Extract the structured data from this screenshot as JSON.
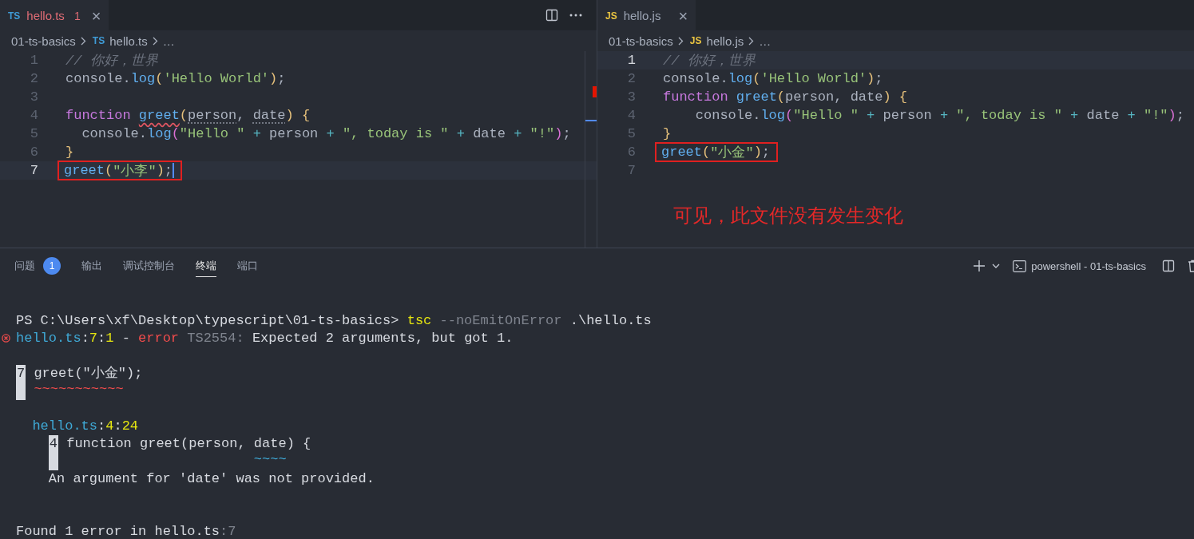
{
  "editors": [
    {
      "tab": {
        "kind": "ts",
        "badge": "TS",
        "title": "hello.ts",
        "has_error": true,
        "problems": "1",
        "close": "×",
        "selected": true
      },
      "actions": [
        {
          "kind": "split"
        },
        {
          "kind": "more"
        }
      ],
      "breadcrumb": {
        "folder": "01-ts-basics",
        "kind": "ts",
        "badge": "TS",
        "file": "hello.ts",
        "tail": "…"
      },
      "lines": [
        {
          "number": "1",
          "tokens": [
            {
              "text": "// 你好，世界",
              "kind": "cmt"
            }
          ]
        },
        {
          "number": "2",
          "tokens": [
            {
              "text": "console.",
              "kind": "plain"
            },
            {
              "text": "log",
              "kind": "fn"
            },
            {
              "text": "(",
              "kind": "b1"
            },
            {
              "text": "'Hello World'",
              "kind": "str"
            },
            {
              "text": ")",
              "kind": "b1"
            },
            {
              "text": ";",
              "kind": "plain"
            }
          ]
        },
        {
          "number": "3"
        },
        {
          "number": "4",
          "tokens": [
            {
              "text": "function ",
              "kind": "kw"
            },
            {
              "text": "greet",
              "kind": "fn-error"
            },
            {
              "text": "(",
              "kind": "b1"
            },
            {
              "text": "person",
              "kind": "param-hint"
            },
            {
              "text": ", ",
              "kind": "plain"
            },
            {
              "text": "date",
              "kind": "param-hint"
            },
            {
              "text": ")",
              "kind": "b1"
            },
            {
              "text": " {",
              "kind": "b1"
            }
          ]
        },
        {
          "number": "5",
          "tokens": [
            {
              "text": "  console.",
              "kind": "plain"
            },
            {
              "text": "log",
              "kind": "fn"
            },
            {
              "text": "(",
              "kind": "b2"
            },
            {
              "text": "\"Hello \"",
              "kind": "str"
            },
            {
              "text": " + ",
              "kind": "op"
            },
            {
              "text": "person",
              "kind": "plain"
            },
            {
              "text": " + ",
              "kind": "op"
            },
            {
              "text": "\", today is \"",
              "kind": "str"
            },
            {
              "text": " + ",
              "kind": "op"
            },
            {
              "text": "date",
              "kind": "plain"
            },
            {
              "text": " + ",
              "kind": "op"
            },
            {
              "text": "\"!\"",
              "kind": "str"
            },
            {
              "text": ")",
              "kind": "b2"
            },
            {
              "text": ";",
              "kind": "plain"
            }
          ]
        },
        {
          "number": "6",
          "tokens": [
            {
              "text": "}",
              "kind": "b1"
            }
          ]
        },
        {
          "number": "7",
          "current": true,
          "boxed": true,
          "cursor": true,
          "tokens": [
            {
              "text": "greet",
              "kind": "fn"
            },
            {
              "text": "(",
              "kind": "b1"
            },
            {
              "text": "\"小李\"",
              "kind": "str"
            },
            {
              "text": ")",
              "kind": "b1"
            },
            {
              "text": ";",
              "kind": "plain"
            }
          ]
        }
      ]
    },
    {
      "tab": {
        "kind": "js",
        "badge": "JS",
        "title": "hello.js",
        "has_error": false,
        "close": "×",
        "selected": true
      },
      "breadcrumb": {
        "folder": "01-ts-basics",
        "kind": "js",
        "badge": "JS",
        "file": "hello.js",
        "tail": "…"
      },
      "lines": [
        {
          "number": "1",
          "current": true,
          "tokens": [
            {
              "text": "// 你好，世界",
              "kind": "cmt"
            }
          ]
        },
        {
          "number": "2",
          "tokens": [
            {
              "text": "console.",
              "kind": "plain"
            },
            {
              "text": "log",
              "kind": "fn"
            },
            {
              "text": "(",
              "kind": "b1"
            },
            {
              "text": "'Hello World'",
              "kind": "str"
            },
            {
              "text": ")",
              "kind": "b1"
            },
            {
              "text": ";",
              "kind": "plain"
            }
          ]
        },
        {
          "number": "3",
          "tokens": [
            {
              "text": "function ",
              "kind": "kw"
            },
            {
              "text": "greet",
              "kind": "fn"
            },
            {
              "text": "(",
              "kind": "b1"
            },
            {
              "text": "person, date",
              "kind": "plain"
            },
            {
              "text": ")",
              "kind": "b1"
            },
            {
              "text": " {",
              "kind": "b1"
            }
          ]
        },
        {
          "number": "4",
          "tokens": [
            {
              "text": "    console.",
              "kind": "plain"
            },
            {
              "text": "log",
              "kind": "fn"
            },
            {
              "text": "(",
              "kind": "b2"
            },
            {
              "text": "\"Hello \"",
              "kind": "str"
            },
            {
              "text": " + ",
              "kind": "op"
            },
            {
              "text": "person",
              "kind": "plain"
            },
            {
              "text": " + ",
              "kind": "op"
            },
            {
              "text": "\", today is \"",
              "kind": "str"
            },
            {
              "text": " + ",
              "kind": "op"
            },
            {
              "text": "date",
              "kind": "plain"
            },
            {
              "text": " + ",
              "kind": "op"
            },
            {
              "text": "\"!\"",
              "kind": "str"
            },
            {
              "text": ")",
              "kind": "b2"
            },
            {
              "text": ";",
              "kind": "plain"
            }
          ]
        },
        {
          "number": "5",
          "tokens": [
            {
              "text": "}",
              "kind": "b1"
            }
          ]
        },
        {
          "number": "6",
          "boxed": true,
          "tokens": [
            {
              "text": "greet",
              "kind": "fn"
            },
            {
              "text": "(",
              "kind": "b1"
            },
            {
              "text": "\"小金\"",
              "kind": "str"
            },
            {
              "text": ")",
              "kind": "b1"
            },
            {
              "text": ";",
              "kind": "plain"
            }
          ]
        },
        {
          "number": "7"
        }
      ],
      "annotation": {
        "text": "可见，此文件没有发生变化"
      }
    }
  ],
  "panel": {
    "tabs": [
      {
        "label": "问题",
        "selected": false,
        "badge": "1"
      },
      {
        "label": "输出",
        "selected": false
      },
      {
        "label": "调试控制台",
        "selected": false
      },
      {
        "label": "终端",
        "selected": true
      },
      {
        "label": "端口",
        "selected": false
      }
    ],
    "shell": "powershell - 01-ts-basics",
    "terminal": [
      {
        "kind": "blank"
      },
      {
        "kind": "text",
        "tokens": [
          {
            "text": "PS C:\\Users\\xf\\Desktop\\typescript\\01-ts-basics> ",
            "kind": "plain"
          },
          {
            "text": "tsc",
            "kind": "cmd"
          },
          {
            "text": " --noEmitOnError",
            "kind": "dim"
          },
          {
            "text": " .\\hello.ts",
            "kind": "plain"
          }
        ]
      },
      {
        "kind": "text",
        "error_mark": true,
        "tokens": [
          {
            "text": "hello.ts",
            "kind": "path"
          },
          {
            "text": ":",
            "kind": "plain"
          },
          {
            "text": "7",
            "kind": "num"
          },
          {
            "text": ":",
            "kind": "plain"
          },
          {
            "text": "1",
            "kind": "num"
          },
          {
            "text": " - ",
            "kind": "plain"
          },
          {
            "text": "error",
            "kind": "err"
          },
          {
            "text": " TS2554:",
            "kind": "dim"
          },
          {
            "text": " Expected 2 arguments, but got 1.",
            "kind": "plain"
          }
        ]
      },
      {
        "kind": "blank"
      },
      {
        "kind": "snippet",
        "number": "7",
        "code": "greet(\"小金\");",
        "marker": {
          "text": "~~~~~~~~~~~",
          "kind": "error"
        }
      },
      {
        "kind": "blank"
      },
      {
        "kind": "text",
        "tokens": [
          {
            "text": "  hello.ts",
            "kind": "path"
          },
          {
            "text": ":",
            "kind": "plain"
          },
          {
            "text": "4",
            "kind": "num"
          },
          {
            "text": ":",
            "kind": "plain"
          },
          {
            "text": "24",
            "kind": "num"
          }
        ],
        "children": [
          {
            "kind": "snippet",
            "number": "4",
            "code": "function greet(person, date) {",
            "marker": {
              "text": "                       ~~~~",
              "kind": "info"
            }
          },
          {
            "kind": "text",
            "tokens": [
              {
                "text": "An argument for 'date' was not provided.",
                "kind": "plain"
              }
            ]
          }
        ]
      },
      {
        "kind": "blank"
      },
      {
        "kind": "blank"
      },
      {
        "kind": "text",
        "tokens": [
          {
            "text": "Found 1 error in hello.ts",
            "kind": "plain"
          },
          {
            "text": ":7",
            "kind": "dim"
          }
        ]
      }
    ]
  }
}
